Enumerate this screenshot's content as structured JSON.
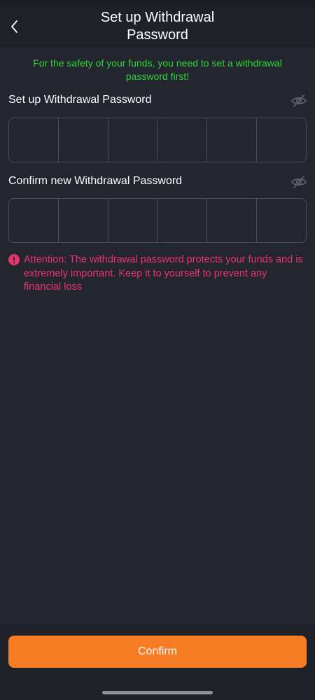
{
  "header": {
    "title_line1": "Set up Withdrawal",
    "title_line2": "Password",
    "back_icon": "chevron-left-icon"
  },
  "notice": {
    "text": "For the safety of your funds, you need to set a withdrawal password first!",
    "color": "#2fd637"
  },
  "fields": [
    {
      "label": "Set up Withdrawal Password",
      "visibility_icon": "eye-off-icon",
      "digits": [
        "",
        "",
        "",
        "",
        "",
        ""
      ]
    },
    {
      "label": "Confirm new Withdrawal Password",
      "visibility_icon": "eye-off-icon",
      "digits": [
        "",
        "",
        "",
        "",
        "",
        ""
      ]
    }
  ],
  "warning": {
    "icon": "alert-circle-icon",
    "text": "Attention: The withdrawal password protects your funds and is extremely important. Keep it to yourself to prevent any financial loss",
    "color": "#e8346f"
  },
  "confirm_button": {
    "label": "Confirm",
    "color": "#f57c23"
  },
  "theme": {
    "background": "#23252f",
    "header_background": "#1f2129",
    "border": "#4b4e5a"
  }
}
